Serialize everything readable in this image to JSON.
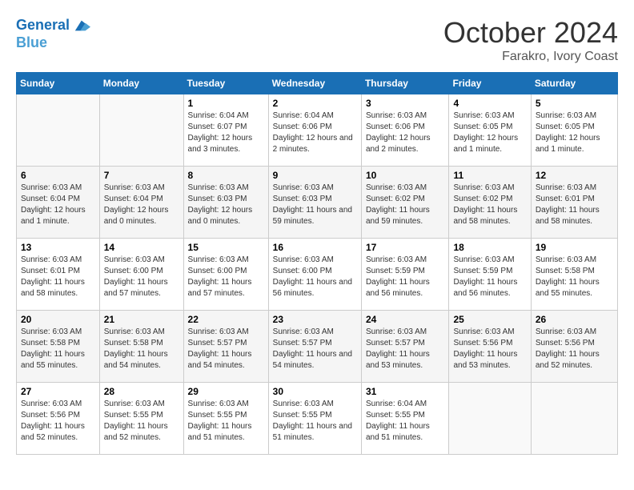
{
  "header": {
    "logo_line1": "General",
    "logo_line2": "Blue",
    "month": "October 2024",
    "location": "Farakro, Ivory Coast"
  },
  "weekdays": [
    "Sunday",
    "Monday",
    "Tuesday",
    "Wednesday",
    "Thursday",
    "Friday",
    "Saturday"
  ],
  "weeks": [
    [
      {
        "day": "",
        "info": ""
      },
      {
        "day": "",
        "info": ""
      },
      {
        "day": "1",
        "info": "Sunrise: 6:04 AM\nSunset: 6:07 PM\nDaylight: 12 hours and 3 minutes."
      },
      {
        "day": "2",
        "info": "Sunrise: 6:04 AM\nSunset: 6:06 PM\nDaylight: 12 hours and 2 minutes."
      },
      {
        "day": "3",
        "info": "Sunrise: 6:03 AM\nSunset: 6:06 PM\nDaylight: 12 hours and 2 minutes."
      },
      {
        "day": "4",
        "info": "Sunrise: 6:03 AM\nSunset: 6:05 PM\nDaylight: 12 hours and 1 minute."
      },
      {
        "day": "5",
        "info": "Sunrise: 6:03 AM\nSunset: 6:05 PM\nDaylight: 12 hours and 1 minute."
      }
    ],
    [
      {
        "day": "6",
        "info": "Sunrise: 6:03 AM\nSunset: 6:04 PM\nDaylight: 12 hours and 1 minute."
      },
      {
        "day": "7",
        "info": "Sunrise: 6:03 AM\nSunset: 6:04 PM\nDaylight: 12 hours and 0 minutes."
      },
      {
        "day": "8",
        "info": "Sunrise: 6:03 AM\nSunset: 6:03 PM\nDaylight: 12 hours and 0 minutes."
      },
      {
        "day": "9",
        "info": "Sunrise: 6:03 AM\nSunset: 6:03 PM\nDaylight: 11 hours and 59 minutes."
      },
      {
        "day": "10",
        "info": "Sunrise: 6:03 AM\nSunset: 6:02 PM\nDaylight: 11 hours and 59 minutes."
      },
      {
        "day": "11",
        "info": "Sunrise: 6:03 AM\nSunset: 6:02 PM\nDaylight: 11 hours and 58 minutes."
      },
      {
        "day": "12",
        "info": "Sunrise: 6:03 AM\nSunset: 6:01 PM\nDaylight: 11 hours and 58 minutes."
      }
    ],
    [
      {
        "day": "13",
        "info": "Sunrise: 6:03 AM\nSunset: 6:01 PM\nDaylight: 11 hours and 58 minutes."
      },
      {
        "day": "14",
        "info": "Sunrise: 6:03 AM\nSunset: 6:00 PM\nDaylight: 11 hours and 57 minutes."
      },
      {
        "day": "15",
        "info": "Sunrise: 6:03 AM\nSunset: 6:00 PM\nDaylight: 11 hours and 57 minutes."
      },
      {
        "day": "16",
        "info": "Sunrise: 6:03 AM\nSunset: 6:00 PM\nDaylight: 11 hours and 56 minutes."
      },
      {
        "day": "17",
        "info": "Sunrise: 6:03 AM\nSunset: 5:59 PM\nDaylight: 11 hours and 56 minutes."
      },
      {
        "day": "18",
        "info": "Sunrise: 6:03 AM\nSunset: 5:59 PM\nDaylight: 11 hours and 56 minutes."
      },
      {
        "day": "19",
        "info": "Sunrise: 6:03 AM\nSunset: 5:58 PM\nDaylight: 11 hours and 55 minutes."
      }
    ],
    [
      {
        "day": "20",
        "info": "Sunrise: 6:03 AM\nSunset: 5:58 PM\nDaylight: 11 hours and 55 minutes."
      },
      {
        "day": "21",
        "info": "Sunrise: 6:03 AM\nSunset: 5:58 PM\nDaylight: 11 hours and 54 minutes."
      },
      {
        "day": "22",
        "info": "Sunrise: 6:03 AM\nSunset: 5:57 PM\nDaylight: 11 hours and 54 minutes."
      },
      {
        "day": "23",
        "info": "Sunrise: 6:03 AM\nSunset: 5:57 PM\nDaylight: 11 hours and 54 minutes."
      },
      {
        "day": "24",
        "info": "Sunrise: 6:03 AM\nSunset: 5:57 PM\nDaylight: 11 hours and 53 minutes."
      },
      {
        "day": "25",
        "info": "Sunrise: 6:03 AM\nSunset: 5:56 PM\nDaylight: 11 hours and 53 minutes."
      },
      {
        "day": "26",
        "info": "Sunrise: 6:03 AM\nSunset: 5:56 PM\nDaylight: 11 hours and 52 minutes."
      }
    ],
    [
      {
        "day": "27",
        "info": "Sunrise: 6:03 AM\nSunset: 5:56 PM\nDaylight: 11 hours and 52 minutes."
      },
      {
        "day": "28",
        "info": "Sunrise: 6:03 AM\nSunset: 5:55 PM\nDaylight: 11 hours and 52 minutes."
      },
      {
        "day": "29",
        "info": "Sunrise: 6:03 AM\nSunset: 5:55 PM\nDaylight: 11 hours and 51 minutes."
      },
      {
        "day": "30",
        "info": "Sunrise: 6:03 AM\nSunset: 5:55 PM\nDaylight: 11 hours and 51 minutes."
      },
      {
        "day": "31",
        "info": "Sunrise: 6:04 AM\nSunset: 5:55 PM\nDaylight: 11 hours and 51 minutes."
      },
      {
        "day": "",
        "info": ""
      },
      {
        "day": "",
        "info": ""
      }
    ]
  ]
}
